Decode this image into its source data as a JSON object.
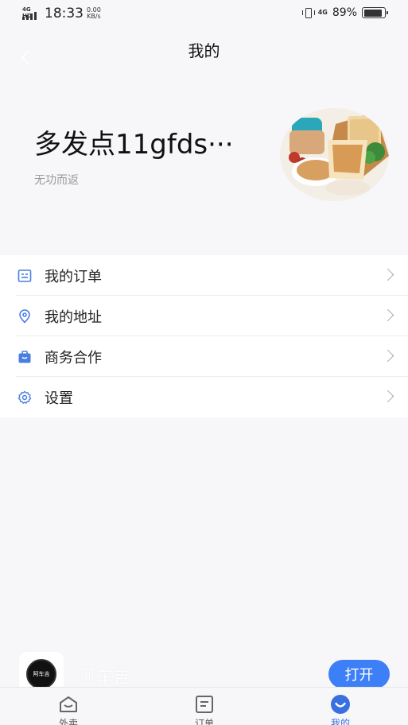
{
  "status_bar": {
    "network_label": "4G HD",
    "time": "18:33",
    "speed_value": "0.00",
    "speed_unit": "KB/s",
    "net_type": "4G",
    "battery_percent": "89%",
    "battery_level": 0.89
  },
  "nav": {
    "title": "我的",
    "back_icon": "chevron-left-icon"
  },
  "profile": {
    "name": "多发点11gfds···",
    "bio": "无功而返",
    "avatar": "food-photo"
  },
  "menu": {
    "items": [
      {
        "label": "我的订单",
        "icon": "order-icon"
      },
      {
        "label": "我的地址",
        "icon": "location-icon"
      },
      {
        "label": "商务合作",
        "icon": "briefcase-icon"
      },
      {
        "label": "设置",
        "icon": "gear-icon"
      }
    ]
  },
  "mini_app": {
    "logo_text": "阿车吉",
    "name": "阿车吉",
    "open_label": "打开"
  },
  "tab_bar": {
    "tabs": [
      {
        "label": "外卖",
        "icon": "home-bag-icon"
      },
      {
        "label": "订单",
        "icon": "list-icon"
      },
      {
        "label": "我的",
        "icon": "smile-icon",
        "active": true
      }
    ]
  },
  "colors": {
    "accent": "#3d7ff6",
    "icon_blue": "#4a7fe0",
    "background": "#f7f7f9"
  }
}
